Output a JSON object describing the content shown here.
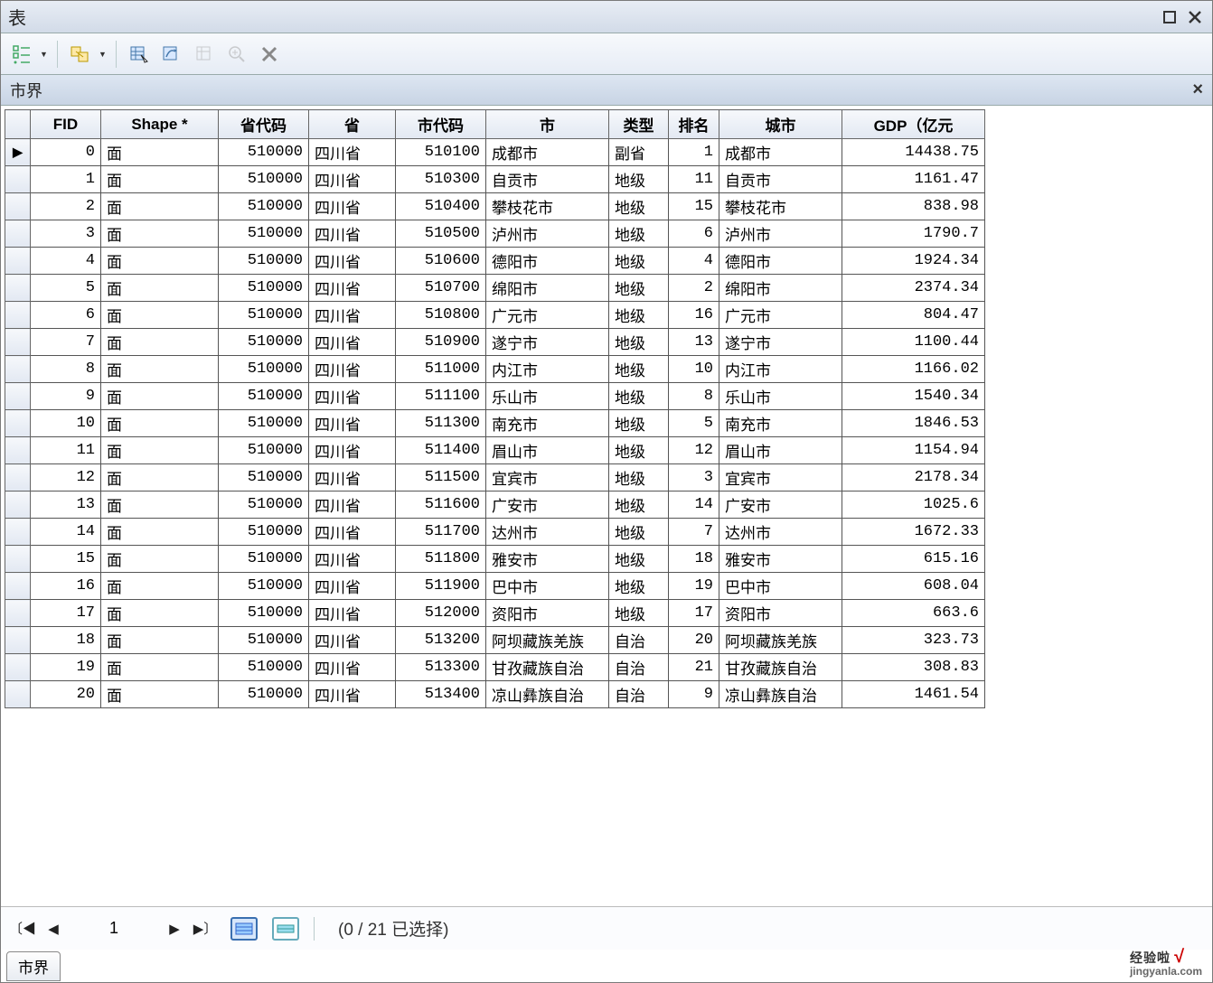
{
  "window": {
    "title": "表"
  },
  "subtitle": "市界",
  "columns": [
    "FID",
    "Shape *",
    "省代码",
    "省",
    "市代码",
    "市",
    "类型",
    "排名",
    "城市",
    "GDP（亿元"
  ],
  "rows": [
    {
      "fid": 0,
      "shape": "面",
      "pcode": 510000,
      "prov": "四川省",
      "ccode": 510100,
      "city": "成都市",
      "type": "副省",
      "rank": 1,
      "cname": "成都市",
      "gdp": "14438.75"
    },
    {
      "fid": 1,
      "shape": "面",
      "pcode": 510000,
      "prov": "四川省",
      "ccode": 510300,
      "city": "自贡市",
      "type": "地级",
      "rank": 11,
      "cname": "自贡市",
      "gdp": "1161.47"
    },
    {
      "fid": 2,
      "shape": "面",
      "pcode": 510000,
      "prov": "四川省",
      "ccode": 510400,
      "city": "攀枝花市",
      "type": "地级",
      "rank": 15,
      "cname": "攀枝花市",
      "gdp": "838.98"
    },
    {
      "fid": 3,
      "shape": "面",
      "pcode": 510000,
      "prov": "四川省",
      "ccode": 510500,
      "city": "泸州市",
      "type": "地级",
      "rank": 6,
      "cname": "泸州市",
      "gdp": "1790.7"
    },
    {
      "fid": 4,
      "shape": "面",
      "pcode": 510000,
      "prov": "四川省",
      "ccode": 510600,
      "city": "德阳市",
      "type": "地级",
      "rank": 4,
      "cname": "德阳市",
      "gdp": "1924.34"
    },
    {
      "fid": 5,
      "shape": "面",
      "pcode": 510000,
      "prov": "四川省",
      "ccode": 510700,
      "city": "绵阳市",
      "type": "地级",
      "rank": 2,
      "cname": "绵阳市",
      "gdp": "2374.34"
    },
    {
      "fid": 6,
      "shape": "面",
      "pcode": 510000,
      "prov": "四川省",
      "ccode": 510800,
      "city": "广元市",
      "type": "地级",
      "rank": 16,
      "cname": "广元市",
      "gdp": "804.47"
    },
    {
      "fid": 7,
      "shape": "面",
      "pcode": 510000,
      "prov": "四川省",
      "ccode": 510900,
      "city": "遂宁市",
      "type": "地级",
      "rank": 13,
      "cname": "遂宁市",
      "gdp": "1100.44"
    },
    {
      "fid": 8,
      "shape": "面",
      "pcode": 510000,
      "prov": "四川省",
      "ccode": 511000,
      "city": "内江市",
      "type": "地级",
      "rank": 10,
      "cname": "内江市",
      "gdp": "1166.02"
    },
    {
      "fid": 9,
      "shape": "面",
      "pcode": 510000,
      "prov": "四川省",
      "ccode": 511100,
      "city": "乐山市",
      "type": "地级",
      "rank": 8,
      "cname": "乐山市",
      "gdp": "1540.34"
    },
    {
      "fid": 10,
      "shape": "面",
      "pcode": 510000,
      "prov": "四川省",
      "ccode": 511300,
      "city": "南充市",
      "type": "地级",
      "rank": 5,
      "cname": "南充市",
      "gdp": "1846.53"
    },
    {
      "fid": 11,
      "shape": "面",
      "pcode": 510000,
      "prov": "四川省",
      "ccode": 511400,
      "city": "眉山市",
      "type": "地级",
      "rank": 12,
      "cname": "眉山市",
      "gdp": "1154.94"
    },
    {
      "fid": 12,
      "shape": "面",
      "pcode": 510000,
      "prov": "四川省",
      "ccode": 511500,
      "city": "宜宾市",
      "type": "地级",
      "rank": 3,
      "cname": "宜宾市",
      "gdp": "2178.34"
    },
    {
      "fid": 13,
      "shape": "面",
      "pcode": 510000,
      "prov": "四川省",
      "ccode": 511600,
      "city": "广安市",
      "type": "地级",
      "rank": 14,
      "cname": "广安市",
      "gdp": "1025.6"
    },
    {
      "fid": 14,
      "shape": "面",
      "pcode": 510000,
      "prov": "四川省",
      "ccode": 511700,
      "city": "达州市",
      "type": "地级",
      "rank": 7,
      "cname": "达州市",
      "gdp": "1672.33"
    },
    {
      "fid": 15,
      "shape": "面",
      "pcode": 510000,
      "prov": "四川省",
      "ccode": 511800,
      "city": "雅安市",
      "type": "地级",
      "rank": 18,
      "cname": "雅安市",
      "gdp": "615.16"
    },
    {
      "fid": 16,
      "shape": "面",
      "pcode": 510000,
      "prov": "四川省",
      "ccode": 511900,
      "city": "巴中市",
      "type": "地级",
      "rank": 19,
      "cname": "巴中市",
      "gdp": "608.04"
    },
    {
      "fid": 17,
      "shape": "面",
      "pcode": 510000,
      "prov": "四川省",
      "ccode": 512000,
      "city": "资阳市",
      "type": "地级",
      "rank": 17,
      "cname": "资阳市",
      "gdp": "663.6"
    },
    {
      "fid": 18,
      "shape": "面",
      "pcode": 510000,
      "prov": "四川省",
      "ccode": 513200,
      "city": "阿坝藏族羌族",
      "type": "自治",
      "rank": 20,
      "cname": "阿坝藏族羌族",
      "gdp": "323.73"
    },
    {
      "fid": 19,
      "shape": "面",
      "pcode": 510000,
      "prov": "四川省",
      "ccode": 513300,
      "city": "甘孜藏族自治",
      "type": "自治",
      "rank": 21,
      "cname": "甘孜藏族自治",
      "gdp": "308.83"
    },
    {
      "fid": 20,
      "shape": "面",
      "pcode": 510000,
      "prov": "四川省",
      "ccode": 513400,
      "city": "凉山彝族自治",
      "type": "自治",
      "rank": 9,
      "cname": "凉山彝族自治",
      "gdp": "1461.54"
    }
  ],
  "nav": {
    "page": "1",
    "status": "(0 / 21 已选择)"
  },
  "tab": "市界",
  "watermark": {
    "top": "经验啦",
    "check": "√",
    "dom": "jingyanla.com"
  },
  "chart_data": {
    "type": "table",
    "title": "市界",
    "columns": [
      "FID",
      "Shape *",
      "省代码",
      "省",
      "市代码",
      "市",
      "类型",
      "排名",
      "城市",
      "GDP（亿元"
    ],
    "series": [
      {
        "name": "GDP（亿元",
        "categories": [
          "成都市",
          "自贡市",
          "攀枝花市",
          "泸州市",
          "德阳市",
          "绵阳市",
          "广元市",
          "遂宁市",
          "内江市",
          "乐山市",
          "南充市",
          "眉山市",
          "宜宾市",
          "广安市",
          "达州市",
          "雅安市",
          "巴中市",
          "资阳市",
          "阿坝藏族羌族",
          "甘孜藏族自治",
          "凉山彝族自治"
        ],
        "values": [
          14438.75,
          1161.47,
          838.98,
          1790.7,
          1924.34,
          2374.34,
          804.47,
          1100.44,
          1166.02,
          1540.34,
          1846.53,
          1154.94,
          2178.34,
          1025.6,
          1672.33,
          615.16,
          608.04,
          663.6,
          323.73,
          308.83,
          1461.54
        ]
      }
    ]
  }
}
